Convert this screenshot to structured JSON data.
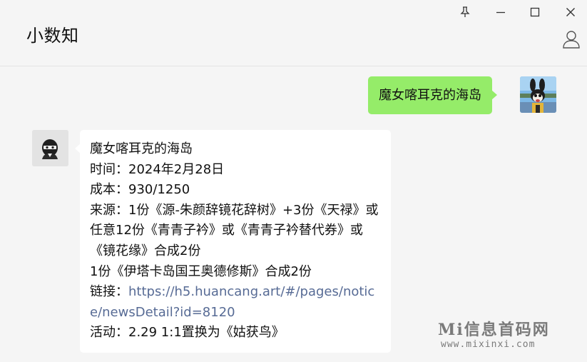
{
  "window": {
    "title": "小数知",
    "controls": {
      "pin_icon": "pin-icon",
      "minimize_icon": "minimize-icon",
      "maximize_icon": "maximize-icon",
      "close_icon": "close-icon",
      "contact_icon": "person-icon"
    }
  },
  "messages": [
    {
      "sender": "me",
      "text": "魔女喀耳克的海岛"
    },
    {
      "sender": "other",
      "lines": [
        "魔女喀耳克的海岛",
        "时间：2024年2月28日",
        "成本：930/1250",
        "来源：1份《源-朱颜辞镜花辞树》+3份《天禄》或任意12份《青青子衿》或《青青子衿替代券》或《镜花缘》合成2份",
        "1份《伊塔卡岛国王奥德修斯》合成2份"
      ],
      "link_prefix": "链接：",
      "link_url": "https://h5.huancang.art/#/pages/notice/newsDetail?id=8120",
      "last_line": "活动：2.29 1:1置换为《姑获鸟》"
    }
  ],
  "watermark": {
    "main": "Mi信息首码网",
    "sub": "www.mixinxi.com"
  },
  "colors": {
    "my_bubble": "#95ec69",
    "other_bubble": "#ffffff",
    "link": "#576b95",
    "background": "#f5f5f5"
  }
}
